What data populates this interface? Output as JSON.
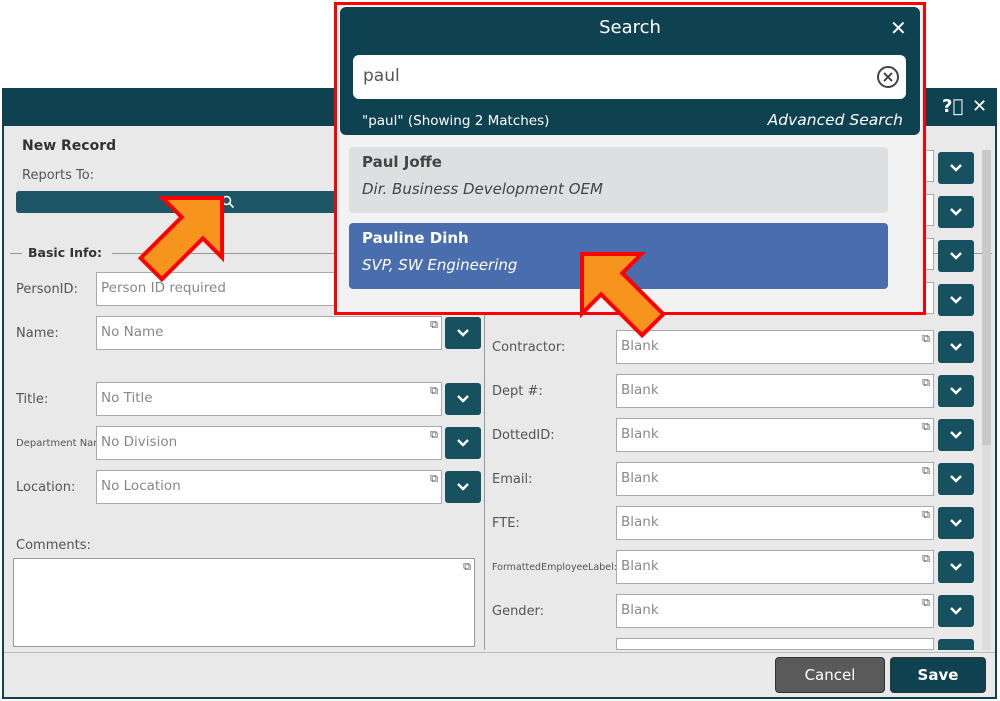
{
  "dialog": {
    "title": "New Record",
    "reports_to_label": "Reports To:",
    "section_label": "Basic Info:",
    "left_fields": [
      {
        "label": "PersonID:",
        "value": "Person ID required"
      },
      {
        "label": "Name:",
        "value": "No Name"
      },
      {
        "label": "Title:",
        "value": "No Title"
      },
      {
        "label": "Department Name:",
        "value": "No Division"
      },
      {
        "label": "Location:",
        "value": "No Location"
      }
    ],
    "comments_label": "Comments:",
    "right_fields": [
      {
        "label": "Contractor:",
        "value": "Blank"
      },
      {
        "label": "Dept #:",
        "value": "Blank"
      },
      {
        "label": "DottedID:",
        "value": "Blank"
      },
      {
        "label": "Email:",
        "value": "Blank"
      },
      {
        "label": "FTE:",
        "value": "Blank"
      },
      {
        "label": "FormattedEmployeeLabel:",
        "value": "Blank"
      },
      {
        "label": "Gender:",
        "value": "Blank"
      }
    ],
    "cancel_label": "Cancel",
    "save_label": "Save"
  },
  "search": {
    "title": "Search",
    "query": "paul",
    "status": "\"paul\" (Showing 2 Matches)",
    "advanced_label": "Advanced Search",
    "results": [
      {
        "name": "Paul Joffe",
        "title": "Dir. Business Development  OEM",
        "selected": false
      },
      {
        "name": "Pauline Dinh",
        "title": "SVP, SW Engineering",
        "selected": true
      }
    ]
  },
  "colors": {
    "header": "#0e4250",
    "selected": "#4a6dad",
    "arrow": "#f7941d",
    "highlight": "#ff0000"
  }
}
